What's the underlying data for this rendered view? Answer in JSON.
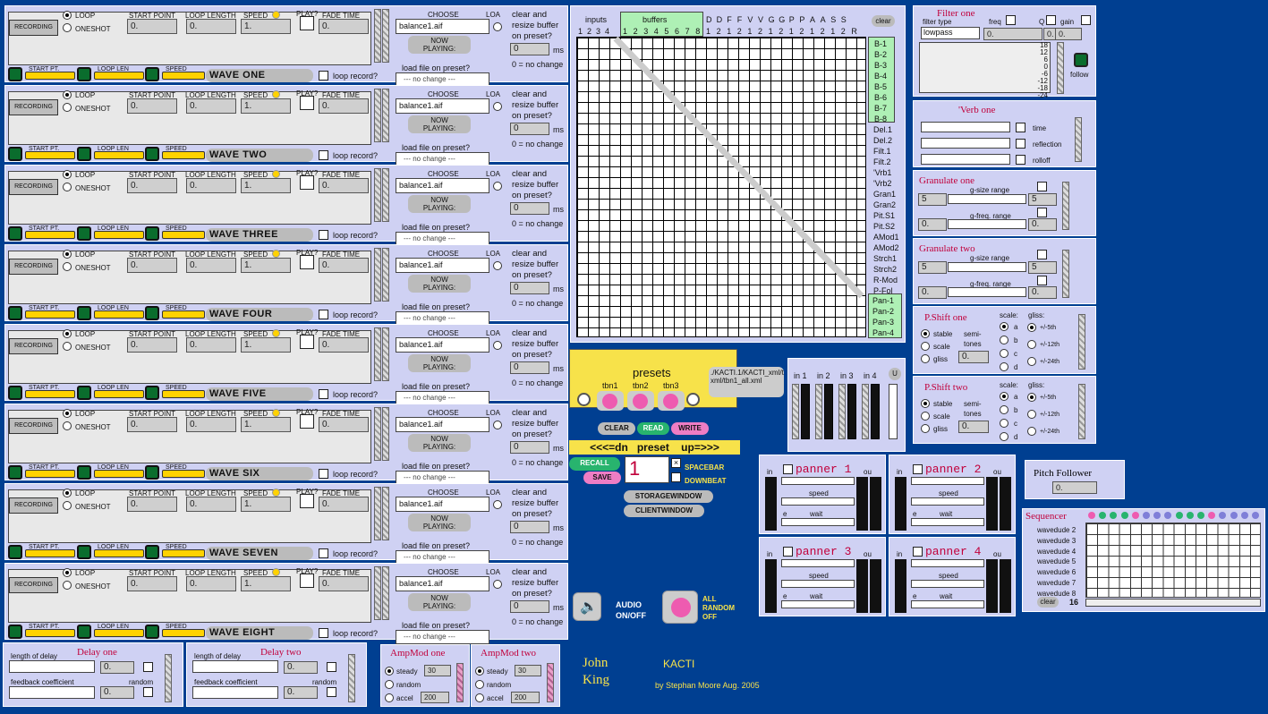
{
  "waves": [
    {
      "title": "WAVE ONE"
    },
    {
      "title": "WAVE TWO"
    },
    {
      "title": "WAVE THREE"
    },
    {
      "title": "WAVE FOUR"
    },
    {
      "title": "WAVE FIVE"
    },
    {
      "title": "WAVE SIX"
    },
    {
      "title": "WAVE SEVEN"
    },
    {
      "title": "WAVE EIGHT"
    }
  ],
  "wave_labels": {
    "recording": "RECORDING",
    "loop": "LOOP",
    "oneshot": "ONESHOT",
    "start_point": "START POINT",
    "loop_length": "LOOP LENGTH",
    "speed": "SPEED",
    "play": "PLAY?",
    "fade_time": "FADE TIME",
    "start_val": "0.",
    "len_val": "0.",
    "speed_val": "1.",
    "fade_val": "0.",
    "start_pt": "START PT.",
    "loop_len": "LOOP LEN",
    "speed_small": "SPEED",
    "loop_record": "loop record?",
    "choose": "CHOOSE",
    "loa": "LOA",
    "file": "balance1.aif",
    "now_playing": "NOW\nPLAYING:",
    "load_file": "load file on preset?",
    "no_change": "--- no change ---",
    "clear_resize": "clear and resize buffer on preset?",
    "ms_val": "0",
    "ms": "ms",
    "zero_note": "0 = no change"
  },
  "matrix": {
    "inputs": "inputs",
    "buffers": "buffers",
    "clear": "clear",
    "input_nums": [
      "1",
      "2",
      "3",
      "4"
    ],
    "buffer_nums": [
      "1",
      "2",
      "3",
      "4",
      "5",
      "6",
      "7",
      "8"
    ],
    "top_cols": [
      "D",
      "D",
      "F",
      "F",
      "V",
      "V",
      "G",
      "G",
      "P",
      "P",
      "A",
      "A",
      "S",
      "S"
    ],
    "top_nums": [
      "1",
      "2",
      "1",
      "2",
      "1",
      "2",
      "1",
      "2",
      "1",
      "2",
      "1",
      "2",
      "1",
      "2"
    ],
    "r": "R",
    "rows_green": [
      "B-1",
      "B-2",
      "B-3",
      "B-4",
      "B-5",
      "B-6",
      "B-7",
      "B-8"
    ],
    "rows_mid": [
      "Del.1",
      "Del.2",
      "Filt.1",
      "Filt.2",
      "'Vrb1",
      "'Vrb2",
      "Gran1",
      "Gran2",
      "Pit.S1",
      "Pit.S2",
      "AMod1",
      "AMod2",
      "Strch1",
      "Strch2",
      "R-Mod",
      "P-Fol"
    ],
    "rows_pan": [
      "Pan-1",
      "Pan-2",
      "Pan-3",
      "Pan-4"
    ]
  },
  "filter": {
    "title": "Filter one",
    "type_label": "filter type",
    "type": "lowpass",
    "freq": "freq",
    "q": "Q",
    "gain": "gain",
    "val1": "0.",
    "val2": "0.",
    "val3": "0.",
    "follow": "follow",
    "db_ticks": [
      "18",
      "12",
      "6",
      "0",
      "-6",
      "-12",
      "-18",
      "-24"
    ]
  },
  "verb": {
    "title": "'Verb one",
    "time": "time",
    "reflection": "reflection",
    "rolloff": "rolloff"
  },
  "gran1": {
    "title": "Granulate one",
    "size": "g-size range",
    "freq": "g-freq. range",
    "v1": "5",
    "v2": "5",
    "v3": "0.",
    "v4": "0."
  },
  "gran2": {
    "title": "Granulate two",
    "size": "g-size range",
    "freq": "g-freq. range",
    "v1": "5",
    "v2": "5",
    "v3": "0.",
    "v4": "0."
  },
  "pshift1": {
    "title": "P.Shift one",
    "stable": "stable",
    "scale": "scale",
    "gliss": "gliss",
    "semi": "semi-\ntones",
    "semi_val": "0.",
    "scale_label": "scale:",
    "notes": [
      "a",
      "b",
      "c",
      "d"
    ],
    "gliss_label": "gliss:",
    "gl": [
      "+/-5th",
      "+/-12th",
      "+/-24th"
    ]
  },
  "pshift2": {
    "title": "P.Shift two",
    "stable": "stable",
    "scale": "scale",
    "gliss": "gliss",
    "semi": "semi-\ntones",
    "semi_val": "0.",
    "scale_label": "scale:",
    "notes": [
      "a",
      "b",
      "c",
      "d"
    ],
    "gliss_label": "gliss:",
    "gl": [
      "+/-5th",
      "+/-12th",
      "+/-24th"
    ]
  },
  "presets": {
    "title": "presets",
    "tbn": [
      "tbn1",
      "tbn2",
      "tbn3"
    ],
    "path": "./KACTI.1/KACTI_xml/tbn-xml/tbn1_all.xml",
    "clear": "CLEAR",
    "read": "READ",
    "write": "WRITE",
    "nav": "<<<=dn   preset    up=>>>",
    "recall": "RECALL",
    "save": "SAVE",
    "num": "1",
    "spacebar": "SPACEBAR",
    "downbeat": "DOWNBEAT",
    "storage": "STORAGEWINDOW",
    "client": "CLIENTWINDOW"
  },
  "inputs": {
    "labels": [
      "in 1",
      "in 2",
      "in 3",
      "in 4"
    ],
    "u": "U"
  },
  "panners": [
    {
      "title": "panner 1"
    },
    {
      "title": "panner 2"
    },
    {
      "title": "panner 3"
    },
    {
      "title": "panner 4"
    }
  ],
  "panner_labels": {
    "in": "in",
    "out": "ou",
    "speed": "speed",
    "wait": "wait",
    "e": "e"
  },
  "pitch": {
    "title": "Pitch Follower",
    "val": "0."
  },
  "sequencer": {
    "title": "Sequencer",
    "rows": [
      "wavedude 2",
      "wavedude 3",
      "wavedude 4",
      "wavedude 5",
      "wavedude 6",
      "wavedude 7",
      "wavedude 8"
    ],
    "clear": "clear",
    "num": "16"
  },
  "audio": {
    "label": "AUDIO\nON/OFF",
    "random": "ALL\nRANDOM\nOFF"
  },
  "credits": {
    "name1": "John",
    "name2": "King",
    "app": "KACTI",
    "by": "by Stephan Moore Aug. 2005"
  },
  "delay1": {
    "title": "Delay one",
    "len": "length of delay",
    "fb": "feedback coefficient",
    "random": "random",
    "v1": "0.",
    "v2": "0."
  },
  "delay2": {
    "title": "Delay two",
    "len": "length of delay",
    "fb": "feedback coefficient",
    "random": "random",
    "v1": "0.",
    "v2": "0."
  },
  "amp1": {
    "title": "AmpMod one",
    "steady": "steady",
    "random": "random",
    "accel": "accel",
    "v1": "30",
    "v2": "200"
  },
  "amp2": {
    "title": "AmpMod two",
    "steady": "steady",
    "random": "random",
    "accel": "accel",
    "v1": "30",
    "v2": "200"
  }
}
